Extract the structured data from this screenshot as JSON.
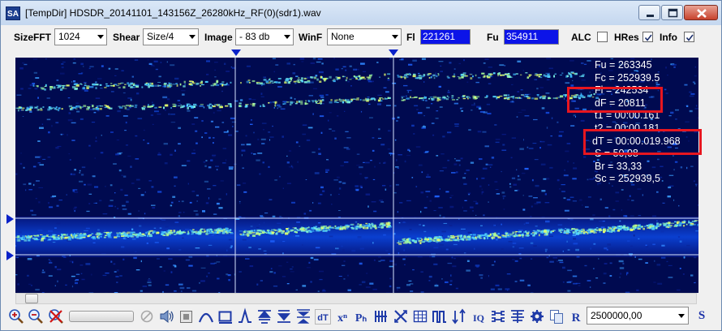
{
  "window": {
    "title": "[TempDir] HDSDR_20141101_143156Z_26280kHz_RF(0)(sdr1).wav",
    "app_icon_text": "SA"
  },
  "toolbar": {
    "sizefft": {
      "label": "SizeFFT",
      "value": "1024"
    },
    "shear": {
      "label": "Shear",
      "value": "Size/4"
    },
    "image": {
      "label": "Image",
      "value": "- 83 db"
    },
    "winf": {
      "label": "WinF",
      "value": "None"
    },
    "fl": {
      "label": "Fl",
      "value": "221261"
    },
    "fu": {
      "label": "Fu",
      "value": "354911"
    },
    "alc": {
      "label": "ALC",
      "checked": false
    },
    "hres": {
      "label": "HRes",
      "checked": true
    },
    "info": {
      "label": "Info",
      "checked": true
    }
  },
  "info_panel": {
    "lines": [
      "Fu = 263345",
      "Fc = 252939.5",
      "Fl = 242534",
      "dF = 20811",
      "t1 = 00:00.161",
      "t2 = 00:00.181",
      "dT = 00:00.019.968",
      "S = 50,08",
      "Br = 33,33",
      "Sc = 252939,5"
    ]
  },
  "bottom": {
    "frequency_value": "2500000,00",
    "s_button": "S",
    "text_icons": {
      "dt": "dT",
      "xn": "xⁿ",
      "ph": "Pₕ",
      "iq": "IQ",
      "r": "R"
    }
  },
  "colors": {
    "waterfall_bg": "#000a50",
    "highlight": "#e8161f",
    "freq_box": "#0c14e8",
    "marker": "#0a22c8"
  }
}
